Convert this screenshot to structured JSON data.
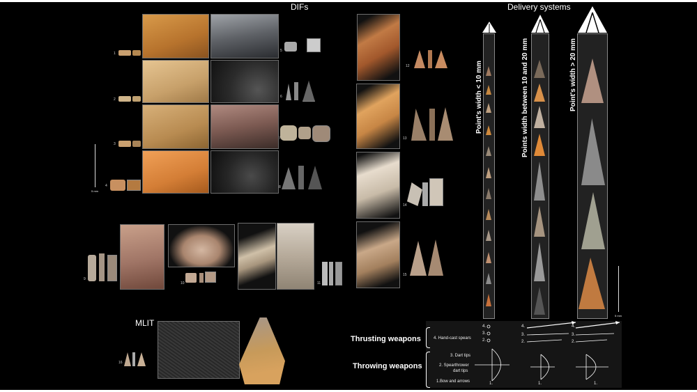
{
  "titles": {
    "difs": "DIFs",
    "delivery": "Delivery systems",
    "mlit": "MLIT"
  },
  "figure_numbers": [
    "1",
    "2",
    "3",
    "4",
    "5",
    "6",
    "7",
    "8",
    "9",
    "10",
    "11",
    "12",
    "13",
    "14",
    "15",
    "16"
  ],
  "columns": [
    {
      "label": "Point's width < 10 mm"
    },
    {
      "label": "Points width between 10 and 20 mm"
    },
    {
      "label": "Point's width > 20 mm"
    }
  ],
  "weapons": {
    "thrusting": "Thrusting weapons",
    "throwing": "Throwing weapons",
    "items": {
      "hand_cast": "4. Hand-cast spears",
      "dart_tips": "3. Dart tips",
      "spearthrower_1": "2. Spearthrower",
      "spearthrower_2": "dart tips",
      "bow": "1.Bow and arrows"
    },
    "numbers": {
      "n4": "4.",
      "n3": "3.",
      "n2": "2.",
      "n1": "1."
    }
  },
  "scale_label": "5 mm",
  "colors": {
    "background": "#000000",
    "frame": "#6e6e6e",
    "panel": "#111111",
    "flint_orange": "#c9893f",
    "flint_grey": "#6b6b6b"
  }
}
